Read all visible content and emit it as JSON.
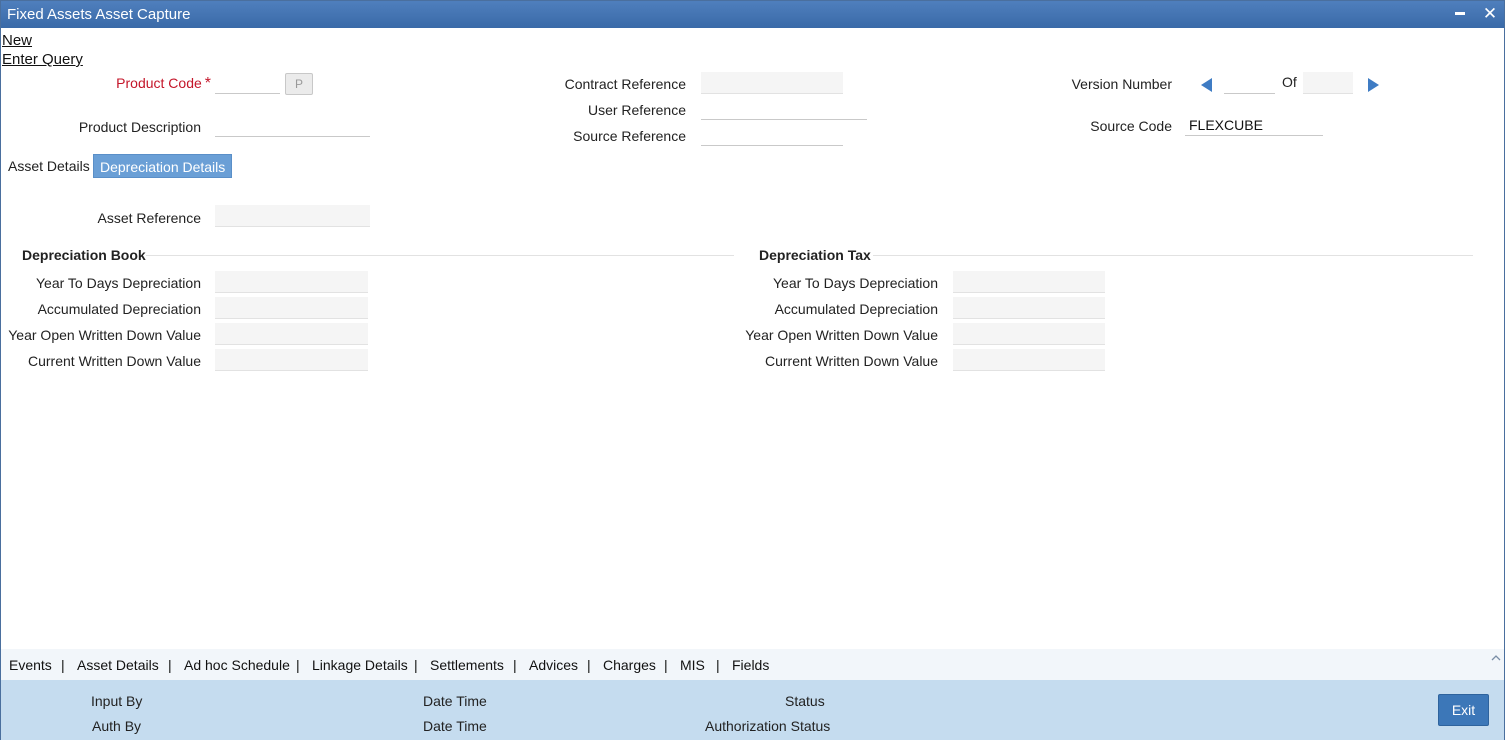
{
  "window": {
    "title": "Fixed Assets Asset Capture"
  },
  "actions": {
    "new": "New",
    "enter_query": "Enter Query"
  },
  "header": {
    "product_code": {
      "label": "Product Code",
      "required_mark": "*",
      "value": "",
      "lov_button": "P"
    },
    "product_description": {
      "label": "Product Description",
      "value": ""
    },
    "contract_reference": {
      "label": "Contract Reference",
      "value": ""
    },
    "user_reference": {
      "label": "User Reference",
      "value": ""
    },
    "source_reference": {
      "label": "Source Reference",
      "value": ""
    },
    "version_number": {
      "label": "Version Number",
      "value": "",
      "of_label": "Of",
      "of_value": ""
    },
    "source_code": {
      "label": "Source Code",
      "value": "FLEXCUBE"
    }
  },
  "tabs": [
    {
      "label": "Asset Details",
      "active": false
    },
    {
      "label": "Depreciation Details",
      "active": true
    }
  ],
  "depreciation": {
    "asset_reference": {
      "label": "Asset Reference",
      "value": ""
    },
    "book": {
      "title": "Depreciation Book",
      "fields": [
        {
          "label": "Year To Days Depreciation",
          "value": ""
        },
        {
          "label": "Accumulated Depreciation",
          "value": ""
        },
        {
          "label": "Year Open Written Down Value",
          "value": ""
        },
        {
          "label": "Current Written Down Value",
          "value": ""
        }
      ]
    },
    "tax": {
      "title": "Depreciation Tax",
      "fields": [
        {
          "label": "Year To Days Depreciation",
          "value": ""
        },
        {
          "label": "Accumulated Depreciation",
          "value": ""
        },
        {
          "label": "Year Open Written Down Value",
          "value": ""
        },
        {
          "label": "Current Written Down Value",
          "value": ""
        }
      ]
    }
  },
  "bottom_tabs": [
    "Events",
    "Asset Details",
    "Ad hoc Schedule",
    "Linkage Details",
    "Settlements",
    "Advices",
    "Charges",
    "MIS",
    "Fields"
  ],
  "bottom_separator": "|",
  "footer": {
    "input_by": "Input By",
    "auth_by": "Auth By",
    "date_time_1": "Date Time",
    "date_time_2": "Date Time",
    "status": "Status",
    "authorization_status": "Authorization Status",
    "exit": "Exit"
  },
  "colors": {
    "titlebar": "#3a6aa8",
    "active_tab": "#6a9fd6",
    "required": "#c4162a",
    "footer": "#c5dcef",
    "exit_button": "#3c77b8",
    "nav_arrow": "#3f7cc4"
  },
  "icons": {
    "minimize": "minimize-icon",
    "close": "close-icon",
    "prev": "arrow-left-icon",
    "next": "arrow-right-icon",
    "collapse": "chevron-up-icon"
  }
}
